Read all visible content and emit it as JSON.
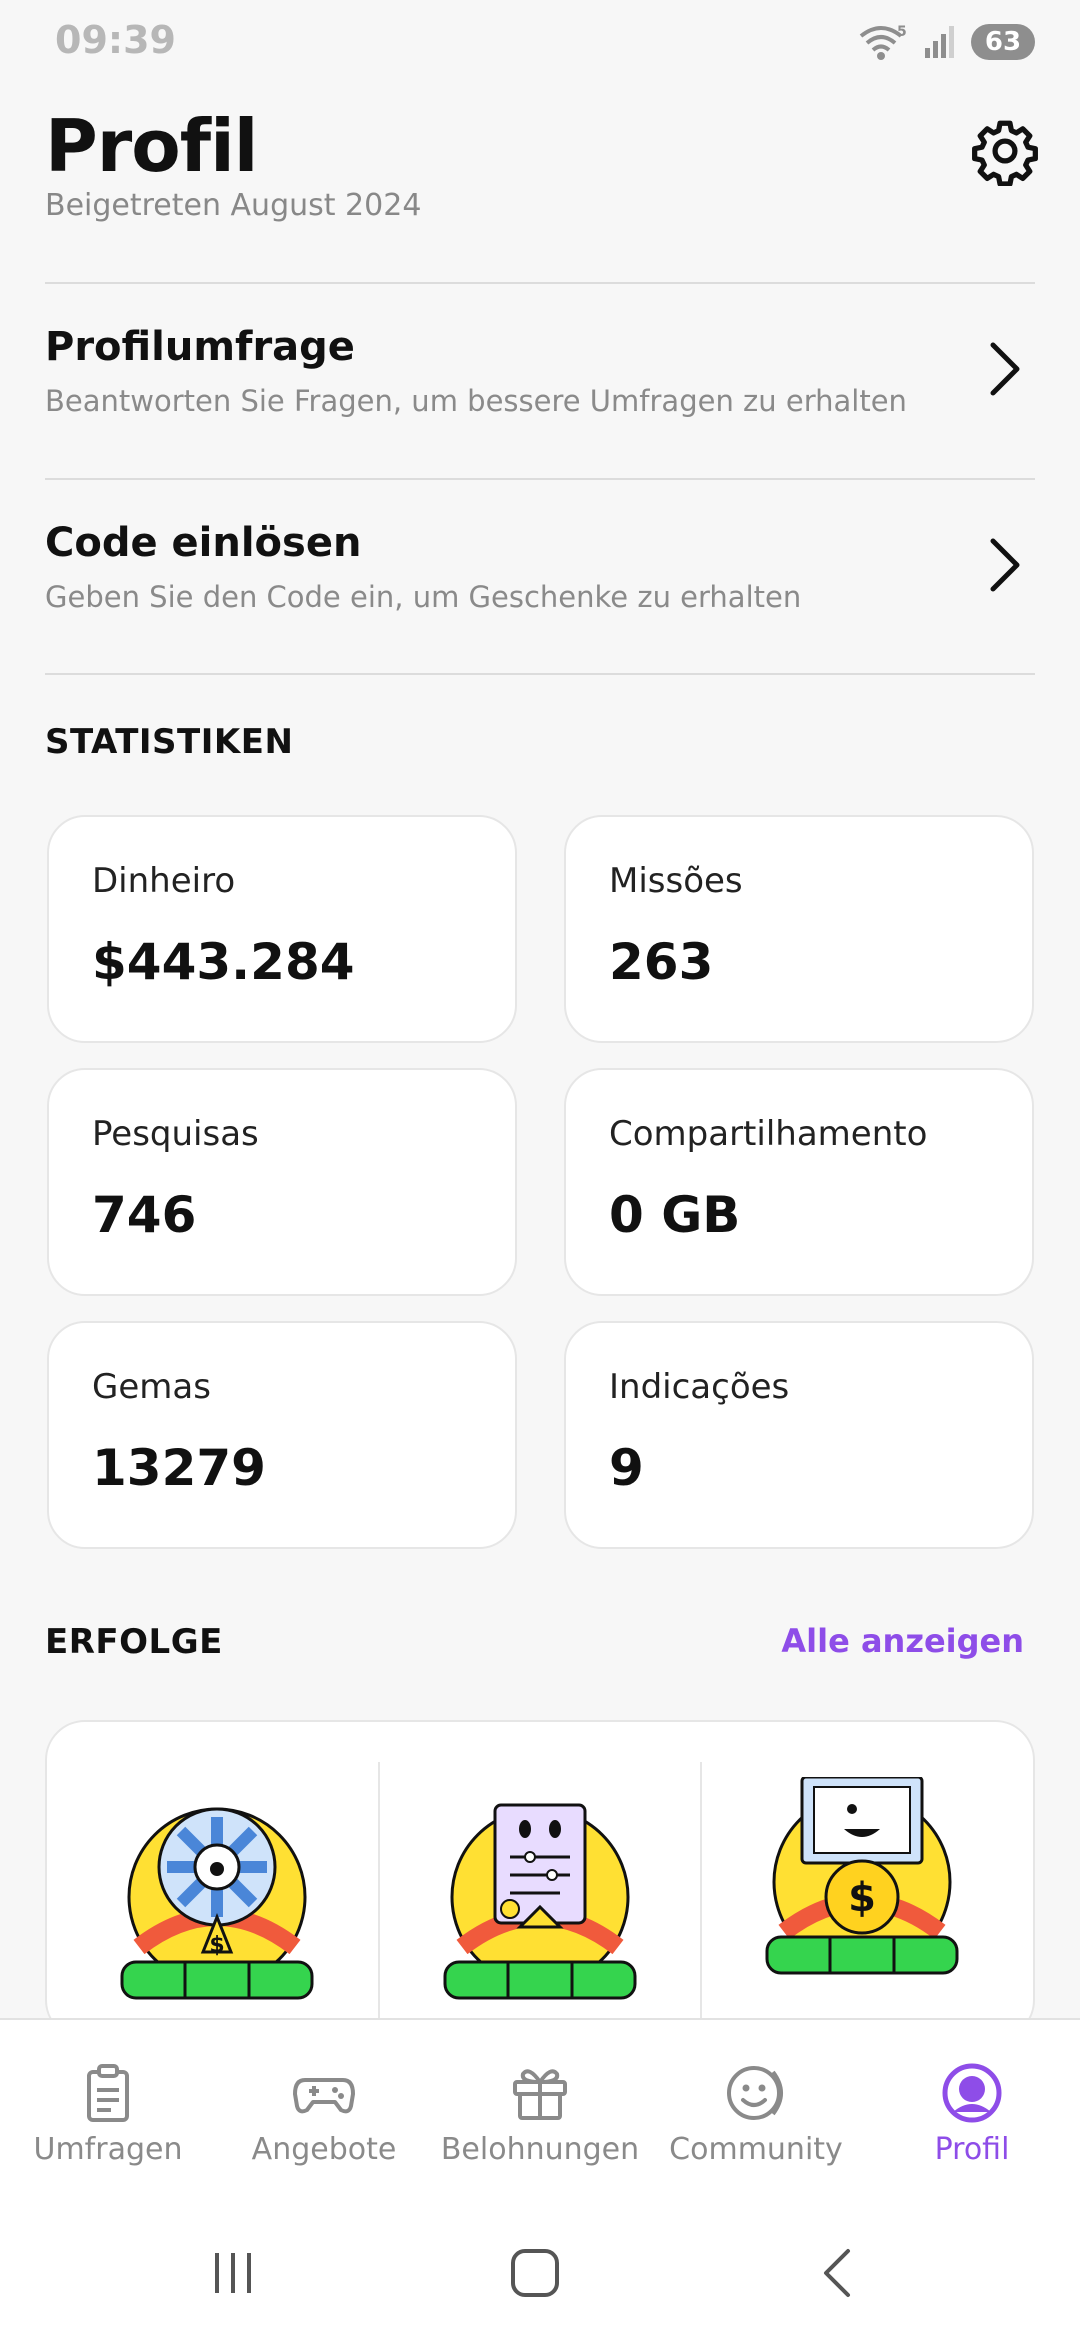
{
  "status_bar": {
    "time": "09:39",
    "battery": "63",
    "wifi_badge": "5"
  },
  "header": {
    "title": "Profil"
  },
  "profile": {
    "joined": "Beigetreten August 2024"
  },
  "menu": [
    {
      "title": "Profilumfrage",
      "subtitle": "Beantworten Sie Fragen, um bessere Umfragen zu erhalten"
    },
    {
      "title": "Code einlösen",
      "subtitle": "Geben Sie den Code ein, um Geschenke zu erhalten"
    }
  ],
  "stats": {
    "section_title": "STATISTIKEN",
    "items": [
      {
        "label": "Dinheiro",
        "value": "$443.284"
      },
      {
        "label": "Missões",
        "value": "263"
      },
      {
        "label": "Pesquisas",
        "value": "746"
      },
      {
        "label": "Compartilhamento",
        "value": "0 GB"
      },
      {
        "label": "Gemas",
        "value": "13279"
      },
      {
        "label": "Indicações",
        "value": "9"
      }
    ]
  },
  "achievements": {
    "section_title": "ERFOLGE",
    "see_all": "Alle anzeigen",
    "badges": [
      "wheel-badge-icon",
      "survey-badge-icon",
      "video-badge-icon"
    ]
  },
  "bottom_nav": [
    {
      "label": "Umfragen",
      "icon": "clipboard-icon",
      "active": false
    },
    {
      "label": "Angebote",
      "icon": "gamepad-icon",
      "active": false
    },
    {
      "label": "Belohnungen",
      "icon": "gift-icon",
      "active": false
    },
    {
      "label": "Community",
      "icon": "smiley-icon",
      "active": false
    },
    {
      "label": "Profil",
      "icon": "profile-icon",
      "active": true
    }
  ],
  "colors": {
    "accent": "#8e4de8",
    "badge_yellow": "#ffe033",
    "badge_green": "#35d44e"
  }
}
